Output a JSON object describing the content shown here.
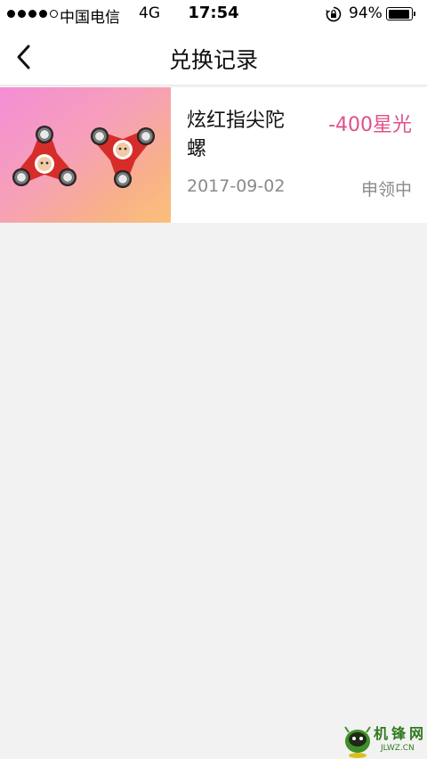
{
  "status_bar": {
    "carrier": "中国电信",
    "network": "4G",
    "time": "17:54",
    "battery_percent": "94%",
    "battery_level": 0.94,
    "signal_bars_filled": 4,
    "signal_bars_total": 5
  },
  "nav": {
    "title": "兑换记录",
    "back_icon": "chevron-left-icon"
  },
  "records": [
    {
      "name": "炫红指尖陀螺",
      "points": "-400星光",
      "date": "2017-09-02",
      "status": "申领中",
      "image_icon": "fidget-spinner-image"
    }
  ],
  "colors": {
    "accent_pink": "#e0508a",
    "secondary_text": "#8a8a8a",
    "background": "#f2f2f2"
  },
  "watermark": {
    "text": "机锋网",
    "domain": "JLWZ.CN"
  }
}
